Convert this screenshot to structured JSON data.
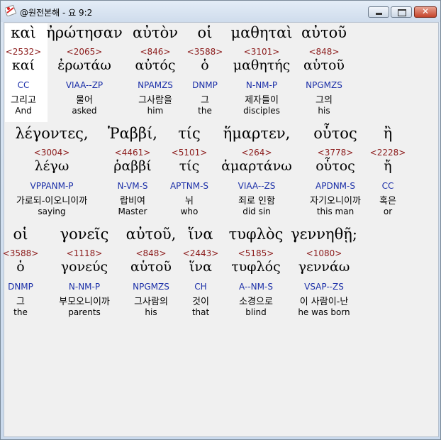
{
  "window": {
    "title": "@원전본해 - 요 9:2",
    "controls": {
      "minimize": "",
      "maximize": "",
      "close": "✕"
    }
  },
  "rows": [
    {
      "words": [
        {
          "greek": "καὶ",
          "strong": "<2532>",
          "lemma": "καί",
          "parse": "CC",
          "korean": "그리고",
          "english": "And"
        },
        {
          "greek": "ἠρώτησαν",
          "strong": "<2065>",
          "lemma": "ἐρωτάω",
          "parse": "VIAA--ZP",
          "korean": "물어",
          "english": "asked"
        },
        {
          "greek": "αὐτὸν",
          "strong": "<846>",
          "lemma": "αὐτός",
          "parse": "NPAMZS",
          "korean": "그사람을",
          "english": "him"
        },
        {
          "greek": "οἱ",
          "strong": "<3588>",
          "lemma": "ὁ",
          "parse": "DNMP",
          "korean": "그",
          "english": "the"
        },
        {
          "greek": "μαθηταὶ",
          "strong": "<3101>",
          "lemma": "μαθητής",
          "parse": "N-NM-P",
          "korean": "제자들이",
          "english": "disciples"
        },
        {
          "greek": "αὐτοῦ",
          "strong": "<848>",
          "lemma": "αὑτοῦ",
          "parse": "NPGMZS",
          "korean": "그의",
          "english": "his"
        }
      ]
    },
    {
      "words": [
        {
          "greek": "λέγοντες,",
          "strong": "<3004>",
          "lemma": "λέγω",
          "parse": "VPPANM-P",
          "korean": "가로되-이오니이까",
          "english": "saying"
        },
        {
          "greek": "Ῥαββί,",
          "strong": "<4461>",
          "lemma": "ῥαββί",
          "parse": "N-VM-S",
          "korean": "랍비여",
          "english": "Master"
        },
        {
          "greek": "τίς",
          "strong": "<5101>",
          "lemma": "τίς",
          "parse": "APTNM-S",
          "korean": "뉘",
          "english": "who"
        },
        {
          "greek": "ἥμαρτεν,",
          "strong": "<264>",
          "lemma": "ἁμαρτάνω",
          "parse": "VIAA--ZS",
          "korean": "죄로 인함",
          "english": "did sin"
        },
        {
          "greek": "οὗτος",
          "strong": "<3778>",
          "lemma": "οὗτος",
          "parse": "APDNM-S",
          "korean": "자기오니이까",
          "english": "this man"
        },
        {
          "greek": "ἢ",
          "strong": "<2228>",
          "lemma": "ἤ",
          "parse": "CC",
          "korean": "혹은",
          "english": "or"
        }
      ]
    },
    {
      "words": [
        {
          "greek": "οἱ",
          "strong": "<3588>",
          "lemma": "ὁ",
          "parse": "DNMP",
          "korean": "그",
          "english": "the"
        },
        {
          "greek": "γονεῖς",
          "strong": "<1118>",
          "lemma": "γονεύς",
          "parse": "N-NM-P",
          "korean": "부모오니이까",
          "english": "parents"
        },
        {
          "greek": "αὐτοῦ,",
          "strong": "<848>",
          "lemma": "αὑτοῦ",
          "parse": "NPGMZS",
          "korean": "그사람의",
          "english": "his"
        },
        {
          "greek": "ἵνα",
          "strong": "<2443>",
          "lemma": "ἵνα",
          "parse": "CH",
          "korean": "것이",
          "english": "that"
        },
        {
          "greek": "τυφλὸς",
          "strong": "<5185>",
          "lemma": "τυφλός",
          "parse": "A--NM-S",
          "korean": "소경으로",
          "english": "blind"
        },
        {
          "greek": "γεννηθῇ;",
          "strong": "<1080>",
          "lemma": "γεννάω",
          "parse": "VSAP--ZS",
          "korean": "이 사람이-난",
          "english": "he was born"
        }
      ]
    }
  ],
  "colors": {
    "strong_number": "#8b1a1a",
    "parsing_code": "#1b2fa8",
    "text": "#000000",
    "selection_background": "#ffffff"
  }
}
